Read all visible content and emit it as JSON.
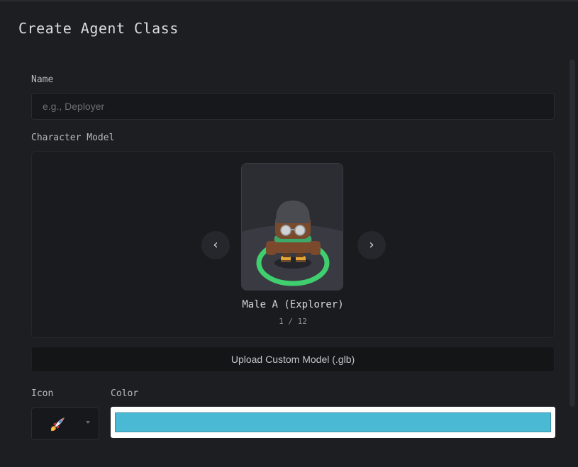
{
  "dialog": {
    "title": "Create Agent Class"
  },
  "form": {
    "name": {
      "label": "Name",
      "value": "",
      "placeholder": "e.g., Deployer"
    },
    "character_model": {
      "label": "Character Model",
      "selected_name": "Male A (Explorer)",
      "position": "1 / 12",
      "prev_icon": "chevron-left-icon",
      "next_icon": "chevron-right-icon",
      "prev_glyph": "‹",
      "next_glyph": "›",
      "upload_label": "Upload Custom Model (.glb)"
    },
    "icon": {
      "label": "Icon",
      "selected": "rocket-icon"
    },
    "color": {
      "label": "Color",
      "value": "#4ab9d3"
    }
  },
  "colors": {
    "background": "#1d1e22",
    "selection_ring": "#3fcf6e",
    "panel": "#1a1b1e"
  }
}
